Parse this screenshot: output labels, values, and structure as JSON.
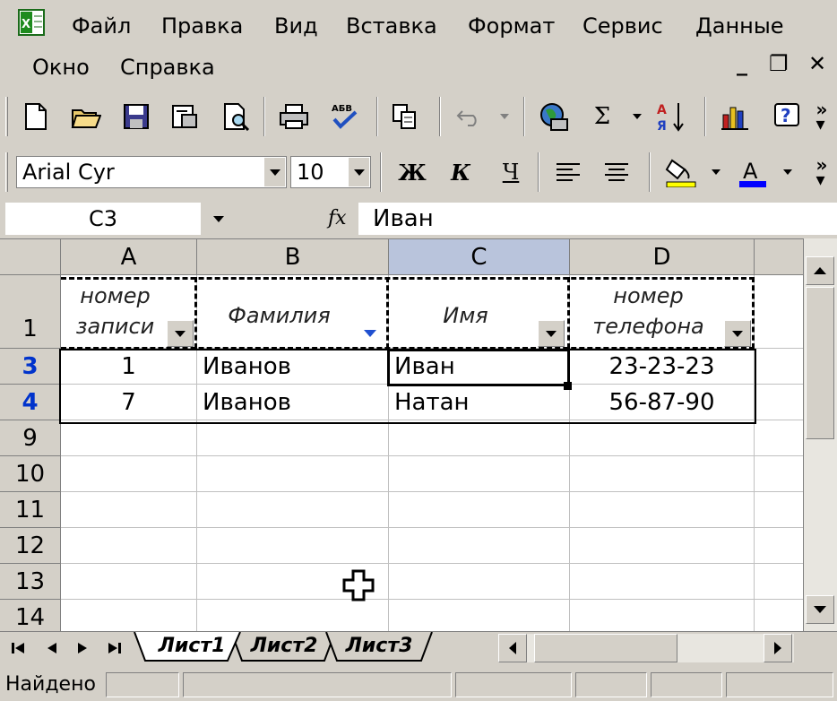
{
  "menu": {
    "items": [
      "Файл",
      "Правка",
      "Вид",
      "Вставка",
      "Формат",
      "Сервис",
      "Данные",
      "Окно",
      "Справка"
    ]
  },
  "window_controls": {
    "minimize": "_",
    "restore": "❐",
    "close": "✕"
  },
  "toolbar_standard": {
    "icons": [
      "new-icon",
      "open-icon",
      "save-icon",
      "permission-icon",
      "print-preview-icon",
      "print-icon",
      "spelling-icon",
      "copy-icon",
      "undo-icon",
      "web-icon",
      "autosum-icon",
      "sort-icon",
      "chart-icon",
      "help-icon"
    ],
    "sum_symbol": "Σ"
  },
  "toolbar_format": {
    "font_name": "Arial Cyr",
    "font_size": "10",
    "bold": "Ж",
    "italic": "К",
    "underline": "Ч",
    "fill_color": "#ffff00",
    "font_color": "#0000ff"
  },
  "formula_bar": {
    "name_box": "C3",
    "fx": "fx",
    "value": "Иван"
  },
  "grid": {
    "columns": [
      "A",
      "B",
      "C",
      "D"
    ],
    "active_column": "C",
    "header_row": {
      "row_label": "1",
      "cells": [
        "номер записи",
        "Фамилия",
        "Имя",
        "номер телефона"
      ]
    },
    "rows": [
      {
        "label": "3",
        "filtered": true,
        "cells": [
          "1",
          "Иванов",
          "Иван",
          "23-23-23"
        ]
      },
      {
        "label": "4",
        "filtered": true,
        "cells": [
          "7",
          "Иванов",
          "Натан",
          "56-87-90"
        ]
      },
      {
        "label": "9",
        "filtered": false,
        "cells": [
          "",
          "",
          "",
          ""
        ]
      },
      {
        "label": "10",
        "filtered": false,
        "cells": [
          "",
          "",
          "",
          ""
        ]
      },
      {
        "label": "11",
        "filtered": false,
        "cells": [
          "",
          "",
          "",
          ""
        ]
      },
      {
        "label": "12",
        "filtered": false,
        "cells": [
          "",
          "",
          "",
          ""
        ]
      },
      {
        "label": "13",
        "filtered": false,
        "cells": [
          "",
          "",
          "",
          ""
        ]
      },
      {
        "label": "14",
        "filtered": false,
        "cells": [
          "",
          "",
          "",
          ""
        ]
      }
    ],
    "selected_cell": "C3"
  },
  "sheet_tabs": [
    "Лист1",
    "Лист2",
    "Лист3"
  ],
  "active_sheet": "Лист1",
  "status": {
    "text": "Найдено"
  }
}
